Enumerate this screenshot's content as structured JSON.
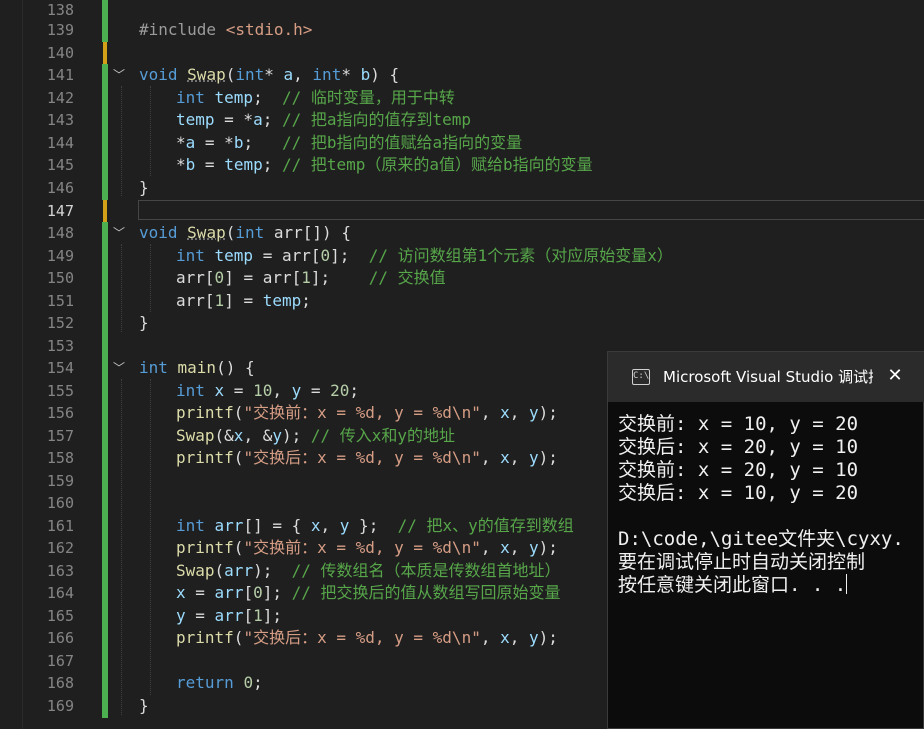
{
  "editor": {
    "line_numbers": [
      "138",
      "139",
      "140",
      "141",
      "142",
      "143",
      "144",
      "145",
      "146",
      "147",
      "148",
      "149",
      "150",
      "151",
      "152",
      "153",
      "154",
      "155",
      "156",
      "157",
      "158",
      "159",
      "160",
      "161",
      "162",
      "163",
      "164",
      "165",
      "166",
      "167",
      "168",
      "169"
    ],
    "code": {
      "l139": {
        "pp": "#include ",
        "inc": "<stdio.h>"
      },
      "l141": {
        "kw1": "void ",
        "fn": "Swap",
        "p1": "(",
        "kw2": "int",
        "p2": "* ",
        "v1": "a",
        ",": ", ",
        "kw3": "int",
        "p3": "* ",
        "v2": "b",
        "p4": ") {"
      },
      "l142": {
        "kw": "int ",
        "var": "temp",
        "p": ";  ",
        "cm": "// 临时变量，用于中转"
      },
      "l143": {
        "var": "temp",
        "p": " = *",
        "v2": "a",
        "p2": "; ",
        "cm": "// 把a指向的值存到temp"
      },
      "l144": {
        "p": "*",
        "v": "a",
        "p2": " = *",
        "v2": "b",
        "p3": ";   ",
        "cm": "// 把b指向的值赋给a指向的变量"
      },
      "l145": {
        "p": "*",
        "v": "b",
        "p2": " = ",
        "v2": "temp",
        "p3": "; ",
        "cm": "// 把temp（原来的a值）赋给b指向的变量"
      },
      "l146": {
        "p": "}"
      },
      "l148": {
        "kw1": "void ",
        "fn": "Swap",
        "p1": "(",
        "kw2": "int ",
        "v": "arr",
        "p2": "[]) {"
      },
      "l149": {
        "kw": "int ",
        "var": "temp",
        "p": " = ",
        "v": "arr",
        "p2": "[",
        "n": "0",
        "p3": "];  ",
        "cm": "// 访问数组第1个元素（对应原始变量x）"
      },
      "l150": {
        "v": "arr",
        "p": "[",
        "n": "0",
        "p2": "] = ",
        "v2": "arr",
        "p3": "[",
        "n2": "1",
        "p4": "];    ",
        "cm": "// 交换值"
      },
      "l151": {
        "v": "arr",
        "p": "[",
        "n": "1",
        "p2": "] = ",
        "v2": "temp",
        "p3": ";"
      },
      "l152": {
        "p": "}"
      },
      "l154": {
        "kw": "int ",
        "fn": "main",
        "p": "() {"
      },
      "l155": {
        "kw": "int ",
        "v": "x",
        "p": " = ",
        "n": "10",
        ",": ", ",
        "v2": "y",
        "p2": " = ",
        "n2": "20",
        "p3": ";"
      },
      "l156": {
        "fn": "printf",
        "p": "(",
        "s": "\"交换前：x = %d, y = %d\\n\"",
        "p2": ", ",
        "v": "x",
        "p3": ", ",
        "v2": "y",
        "p4": ");"
      },
      "l157": {
        "fn": "Swap",
        "p": "(&",
        "v": "x",
        "p2": ", &",
        "v2": "y",
        "p3": "); ",
        "cm": "// 传入x和y的地址"
      },
      "l158": {
        "fn": "printf",
        "p": "(",
        "s": "\"交换后：x = %d, y = %d\\n\"",
        "p2": ", ",
        "v": "x",
        "p3": ", ",
        "v2": "y",
        "p4": ");"
      },
      "l161": {
        "kw": "int ",
        "v": "arr",
        "p": "[] = { ",
        "v2": "x",
        "p2": ", ",
        "v3": "y",
        "p3": " };  ",
        "cm": "// 把x、y的值存到数组"
      },
      "l162": {
        "fn": "printf",
        "p": "(",
        "s": "\"交换前：x = %d, y = %d\\n\"",
        "p2": ", ",
        "v": "x",
        "p3": ", ",
        "v2": "y",
        "p4": ");"
      },
      "l163": {
        "fn": "Swap",
        "p": "(",
        "v": "arr",
        "p2": ");  ",
        "cm": "// 传数组名（本质是传数组首地址）"
      },
      "l164": {
        "v": "x",
        "p": " = ",
        "v2": "arr",
        "p2": "[",
        "n": "0",
        "p3": "]; ",
        "cm": "// 把交换后的值从数组写回原始变量"
      },
      "l165": {
        "v": "y",
        "p": " = ",
        "v2": "arr",
        "p2": "[",
        "n": "1",
        "p3": "];"
      },
      "l166": {
        "fn": "printf",
        "p": "(",
        "s": "\"交换后：x = %d, y = %d\\n\"",
        "p2": ", ",
        "v": "x",
        "p3": ", ",
        "v2": "y",
        "p4": ");"
      },
      "l168": {
        "kw": "return ",
        "n": "0",
        "p": ";"
      },
      "l169": {
        "p": "}"
      }
    },
    "fold_glyph": "﹀"
  },
  "console": {
    "title": "Microsoft Visual Studio 调试控",
    "icon_text": "C:\\",
    "close_label": "✕",
    "lines": [
      "交换前: x = 10, y = 20",
      "交换后: x = 20, y = 10",
      "交换前: x = 20, y = 10",
      "交换后: x = 10, y = 20",
      "",
      "D:\\code,\\gitee文件夹\\cyxy.",
      "要在调试停止时自动关闭控制",
      "按任意键关闭此窗口. . ."
    ]
  },
  "colors": {
    "background": "#1f1f1f",
    "keyword": "#569cd6",
    "function": "#dcdcaa",
    "variable": "#9cdcfe",
    "comment": "#57a64a",
    "string": "#d69d85",
    "number": "#b5cea8",
    "change_saved": "#4caf50",
    "change_pending": "#d4a017",
    "console_bg": "#0c0c0c"
  }
}
